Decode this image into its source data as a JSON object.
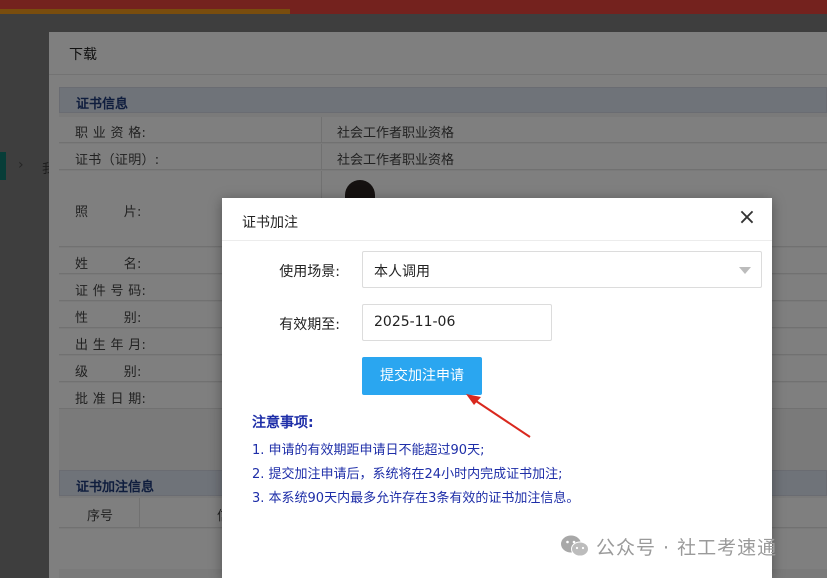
{
  "download_window": {
    "title": "下载",
    "cert_section_title": "证书信息",
    "rows": [
      {
        "label": "职 业 资 格:",
        "value": "社会工作者职业资格"
      },
      {
        "label": "证书（证明）:",
        "value": "社会工作者职业资格"
      },
      {
        "label": "照        片:",
        "value": ""
      },
      {
        "label": "姓        名:",
        "value": ""
      },
      {
        "label": "证 件 号 码:",
        "value": ""
      },
      {
        "label": "性        别:",
        "value": ""
      },
      {
        "label": "出 生 年 月:",
        "value": ""
      },
      {
        "label": "级        别:",
        "value": ""
      },
      {
        "label": "批 准 日 期:",
        "value": ""
      }
    ],
    "addon_section_title": "证书加注信息",
    "addon_columns": [
      "序号",
      "信"
    ]
  },
  "modal": {
    "title": "证书加注",
    "scene_label": "使用场景:",
    "scene_value": "本人调用",
    "expiry_label": "有效期至:",
    "expiry_value": "2025-11-06",
    "submit_label": "提交加注申请",
    "notes_title": "注意事项:",
    "notes": [
      "1. 申请的有效期距申请日不能超过90天;",
      "2. 提交加注申请后，系统将在24小时内完成证书加注;",
      "3. 本系统90天内最多允许存在3条有效的证书加注信息。"
    ]
  },
  "background": {
    "cut_text": "我"
  },
  "watermark": {
    "text": "公众号 · 社工考速通"
  },
  "colors": {
    "topbar": "#e8453c",
    "topbar_progress": "#f29a1c",
    "button": "#2aa6f0",
    "notes_text": "#1e2ea8",
    "section_header": "#1e3a7a",
    "arrow": "#d9281e"
  }
}
